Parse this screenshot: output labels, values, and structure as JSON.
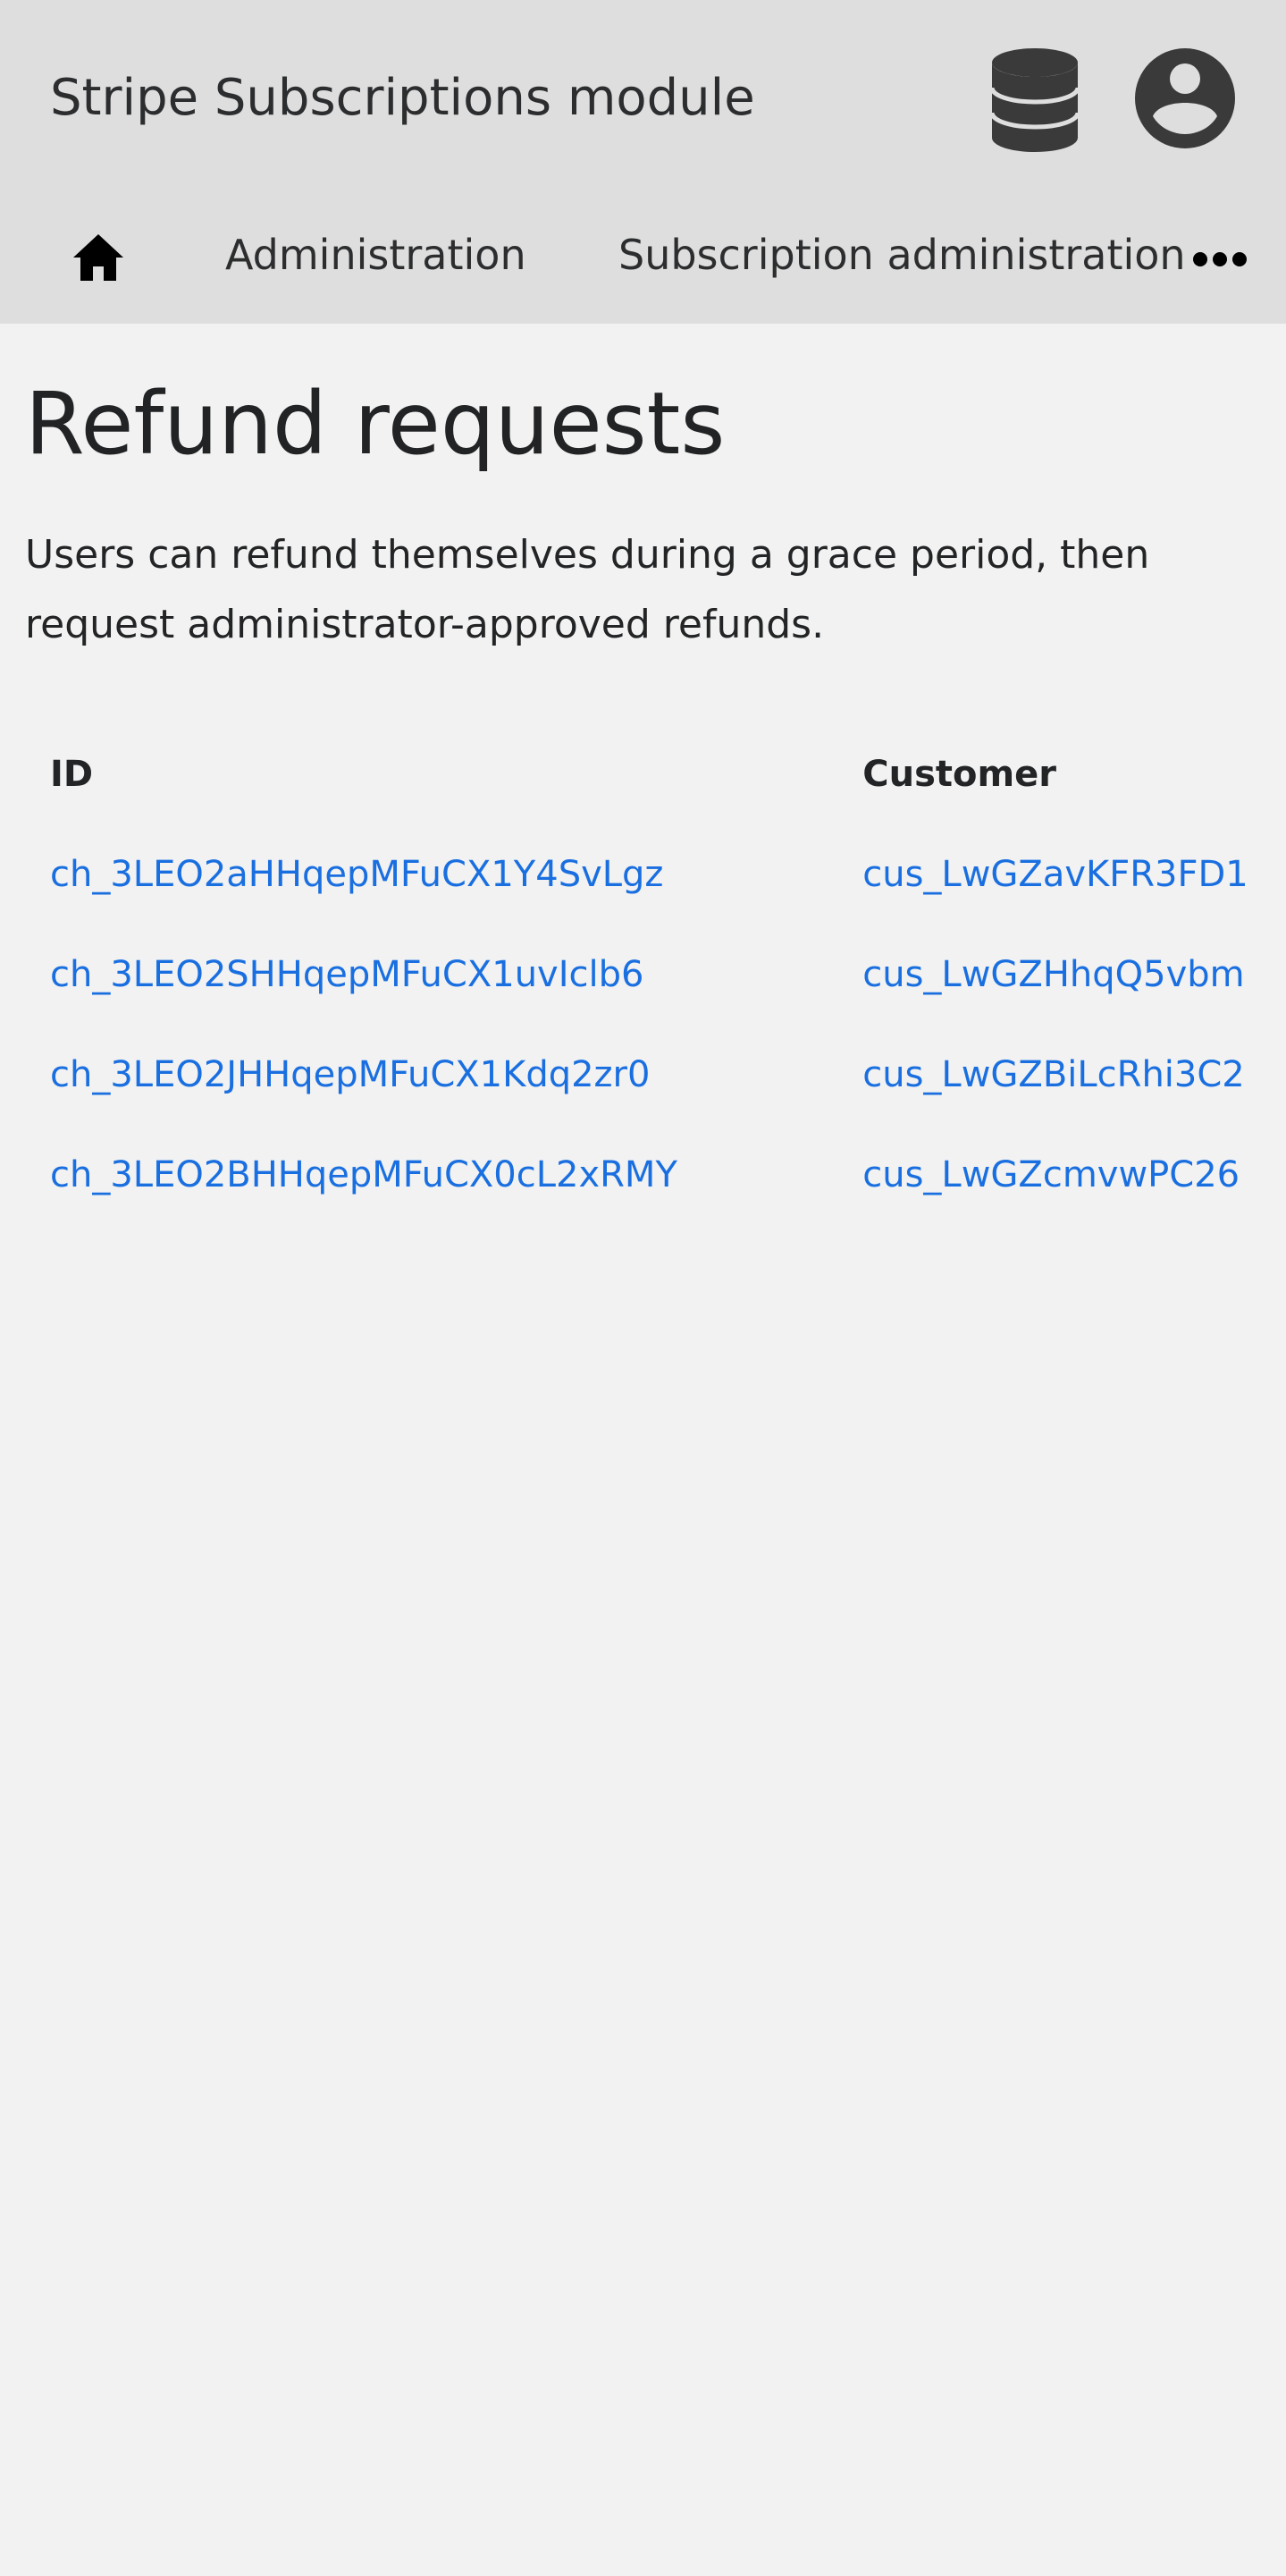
{
  "header": {
    "app_title": "Stripe Subscriptions module",
    "icons": [
      "database-icon",
      "user-account-icon"
    ]
  },
  "nav": {
    "home_icon": "home-icon",
    "items": [
      {
        "label": "Administration"
      },
      {
        "label": "Subscription administration"
      }
    ],
    "more_icon": "more-dots-icon"
  },
  "page": {
    "title": "Refund requests",
    "intro": "Users can refund themselves during a grace period, then request administrator-approved refunds."
  },
  "table": {
    "columns": [
      "ID",
      "Customer"
    ],
    "rows": [
      {
        "id": "ch_3LEO2aHHqepMFuCX1Y4SvLgz",
        "customer": "cus_LwGZavKFR3FD1"
      },
      {
        "id": "ch_3LEO2SHHqepMFuCX1uvIclb6",
        "customer": "cus_LwGZHhqQ5vbm"
      },
      {
        "id": "ch_3LEO2JHHqepMFuCX1Kdq2zr0",
        "customer": "cus_LwGZBiLcRhi3C2"
      },
      {
        "id": "ch_3LEO2BHHqepMFuCX0cL2xRMY",
        "customer": "cus_LwGZcmvwPC26"
      }
    ]
  },
  "colors": {
    "header_bg": "#dedede",
    "page_bg": "#f2f2f2",
    "link": "#1a6fe0",
    "icon": "#3a3a3a"
  }
}
